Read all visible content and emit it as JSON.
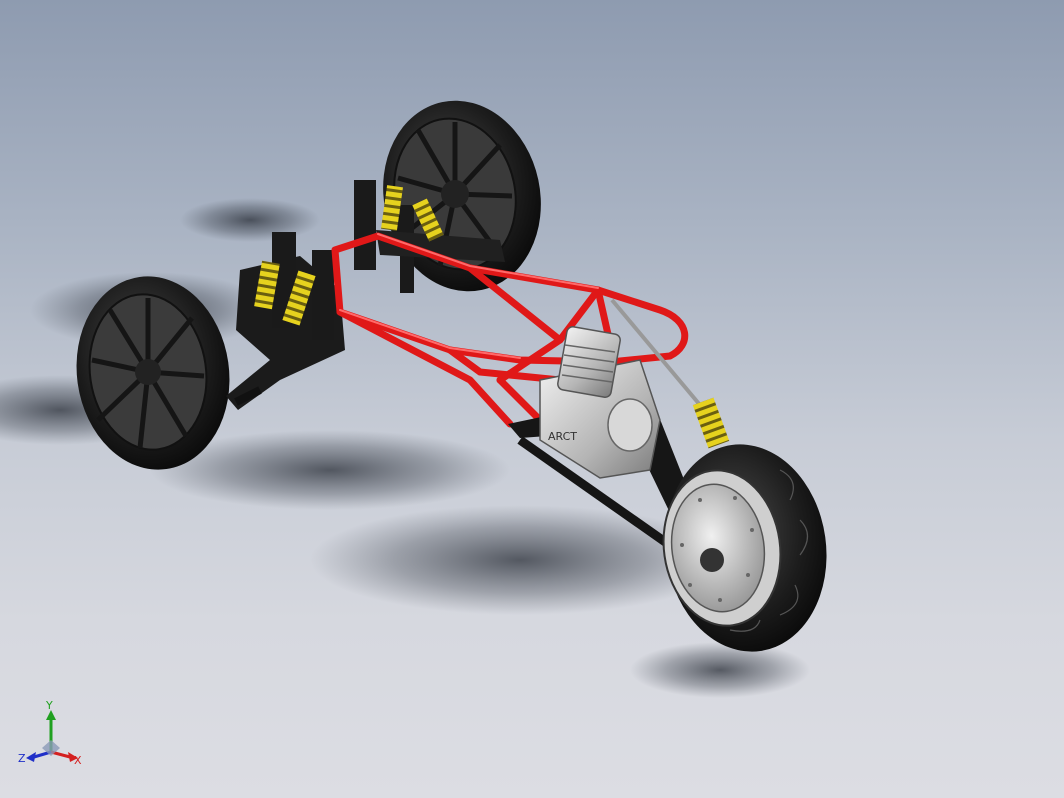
{
  "viewport": {
    "background_top": "#8e9bb0",
    "background_bottom": "#dcdde3"
  },
  "model": {
    "frame_color": "#e01818",
    "spring_color": "#e6d21e",
    "tire_color": "#1e1e1e",
    "wheel_color": "#2a2a2a",
    "engine_color": "#c8c8c8",
    "engine_badge": "ARCT"
  },
  "triad": {
    "x_label": "X",
    "y_label": "Y",
    "z_label": "Z",
    "x_color": "#d42020",
    "y_color": "#20a020",
    "z_color": "#2030c8"
  }
}
